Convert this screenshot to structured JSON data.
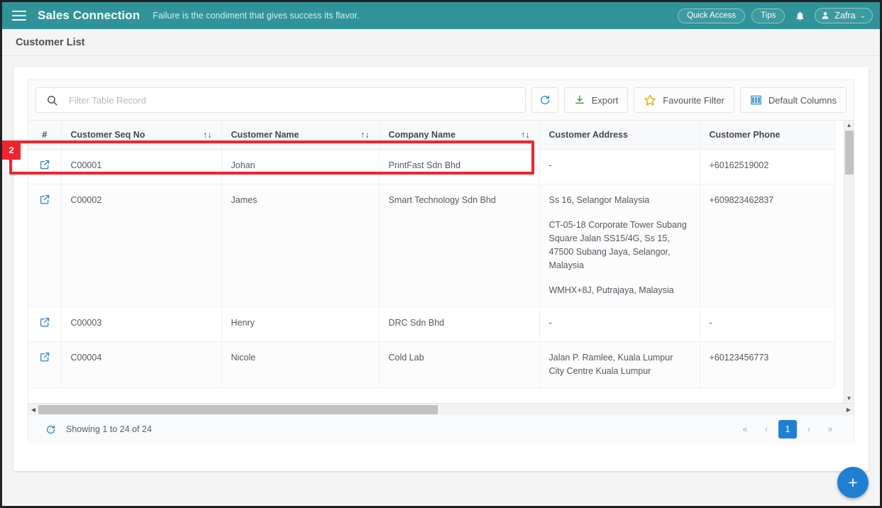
{
  "topbar": {
    "menu_icon": "hamburger-icon",
    "brand": "Sales Connection",
    "tagline": "Failure is the condiment that gives success its flavor.",
    "quick_access_label": "Quick Access",
    "tips_label": "Tips",
    "bell_icon": "bell-icon",
    "user_name": "Zafra",
    "chevron": "⌄",
    "bg_color": "#2f9399"
  },
  "page": {
    "title": "Customer List"
  },
  "toolbar": {
    "search_placeholder": "Filter Table Record",
    "search_value": "",
    "search_icon": "search-icon",
    "refresh_icon": "refresh-icon",
    "export_label": "Export",
    "export_icon": "download-icon",
    "favourite_filter_label": "Favourite Filter",
    "favourite_filter_icon": "star-icon",
    "default_columns_label": "Default Columns",
    "default_columns_icon": "columns-icon"
  },
  "annotation": {
    "badge": "2",
    "color": "#f5222d"
  },
  "table": {
    "columns": [
      {
        "label": "#",
        "sortable": false
      },
      {
        "label": "Customer Seq No",
        "sortable": true
      },
      {
        "label": "Customer Name",
        "sortable": true
      },
      {
        "label": "Company Name",
        "sortable": true
      },
      {
        "label": "Customer Address",
        "sortable": false
      },
      {
        "label": "Customer Phone",
        "sortable": false
      }
    ],
    "sort_icon": "↑↓",
    "row_action_icon": "open-in-new-icon",
    "rows": [
      {
        "seq_no": "C00001",
        "customer_name": "Johan",
        "company_name": "PrintFast Sdn Bhd",
        "address": [
          "-"
        ],
        "phone": "+60162519002"
      },
      {
        "seq_no": "C00002",
        "customer_name": "James",
        "company_name": "Smart Technology Sdn Bhd",
        "address": [
          "Ss 16, Selangor Malaysia",
          "CT-05-18 Corporate Tower Subang Square Jalan SS15/4G, Ss 15, 47500 Subang Jaya, Selangor, Malaysia",
          "WMHX+8J, Putrajaya, Malaysia"
        ],
        "phone": "+609823462837"
      },
      {
        "seq_no": "C00003",
        "customer_name": "Henry",
        "company_name": "DRC Sdn Bhd",
        "address": [
          "-"
        ],
        "phone": "-"
      },
      {
        "seq_no": "C00004",
        "customer_name": "Nicole",
        "company_name": "Cold Lab",
        "address": [
          "Jalan P. Ramlee, Kuala Lumpur City Centre Kuala Lumpur"
        ],
        "phone": "+60123456773"
      }
    ]
  },
  "footer": {
    "refresh_icon": "refresh-icon",
    "showing_text": "Showing 1 to 24 of 24",
    "pagination": {
      "first": "«",
      "prev": "‹",
      "pages": [
        "1"
      ],
      "current_page": "1",
      "next": "›",
      "last": "»"
    }
  },
  "fab": {
    "label": "+",
    "icon": "plus-icon",
    "color": "#1f7fd4"
  }
}
